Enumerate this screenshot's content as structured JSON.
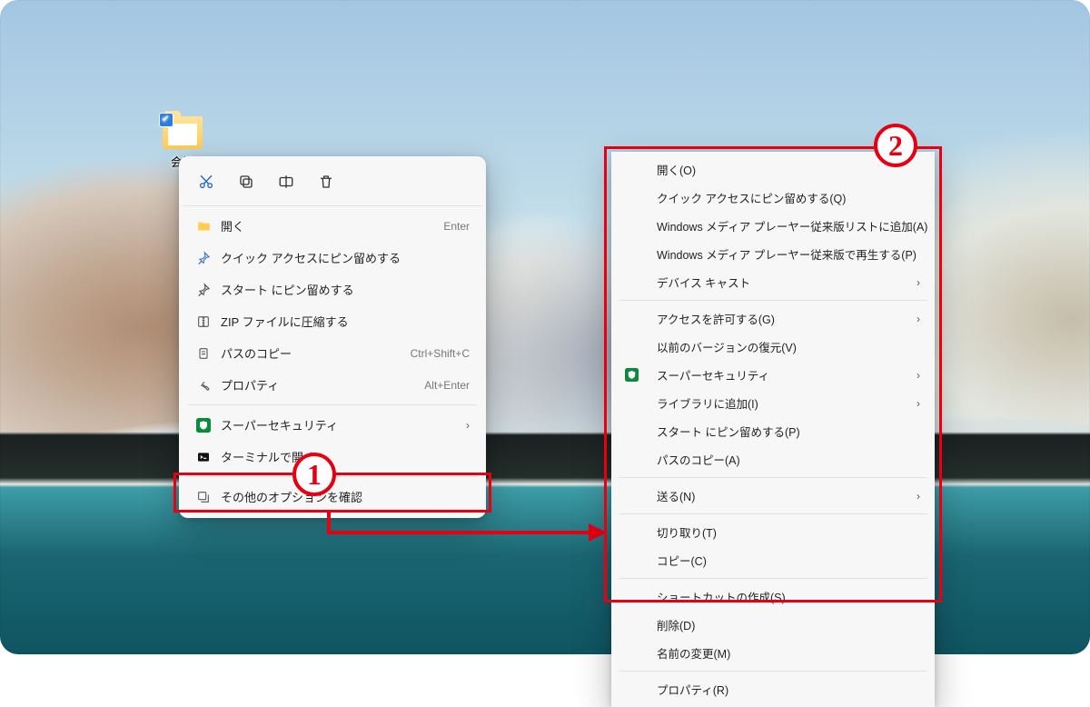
{
  "folder": {
    "label": "会議"
  },
  "menu1": {
    "open": {
      "label": "開く",
      "accel": "Enter"
    },
    "pin_quick": {
      "label": "クイック アクセスにピン留めする"
    },
    "pin_start": {
      "label": "スタート にピン留めする"
    },
    "zip": {
      "label": "ZIP ファイルに圧縮する"
    },
    "copy_path": {
      "label": "パスのコピー",
      "accel": "Ctrl+Shift+C"
    },
    "props": {
      "label": "プロパティ",
      "accel": "Alt+Enter"
    },
    "security": {
      "label": "スーパーセキュリティ"
    },
    "terminal": {
      "label": "ターミナルで開く"
    },
    "more": {
      "label": "その他のオプションを確認"
    }
  },
  "menu2": {
    "open": "開く(O)",
    "pin_quick": "クイック アクセスにピン留めする(Q)",
    "wmp_add": "Windows メディア プレーヤー従来版リストに追加(A)",
    "wmp_play": "Windows メディア プレーヤー従来版で再生する(P)",
    "cast": "デバイス キャスト",
    "access": "アクセスを許可する(G)",
    "prev_ver": "以前のバージョンの復元(V)",
    "security": "スーパーセキュリティ",
    "library": "ライブラリに追加(I)",
    "pin_start": "スタート にピン留めする(P)",
    "copy_path": "パスのコピー(A)",
    "send": "送る(N)",
    "cut": "切り取り(T)",
    "copy": "コピー(C)",
    "shortcut": "ショートカットの作成(S)",
    "delete": "削除(D)",
    "rename": "名前の変更(M)",
    "props": "プロパティ(R)"
  },
  "badges": {
    "one": "1",
    "two": "2"
  },
  "chevron": "›"
}
